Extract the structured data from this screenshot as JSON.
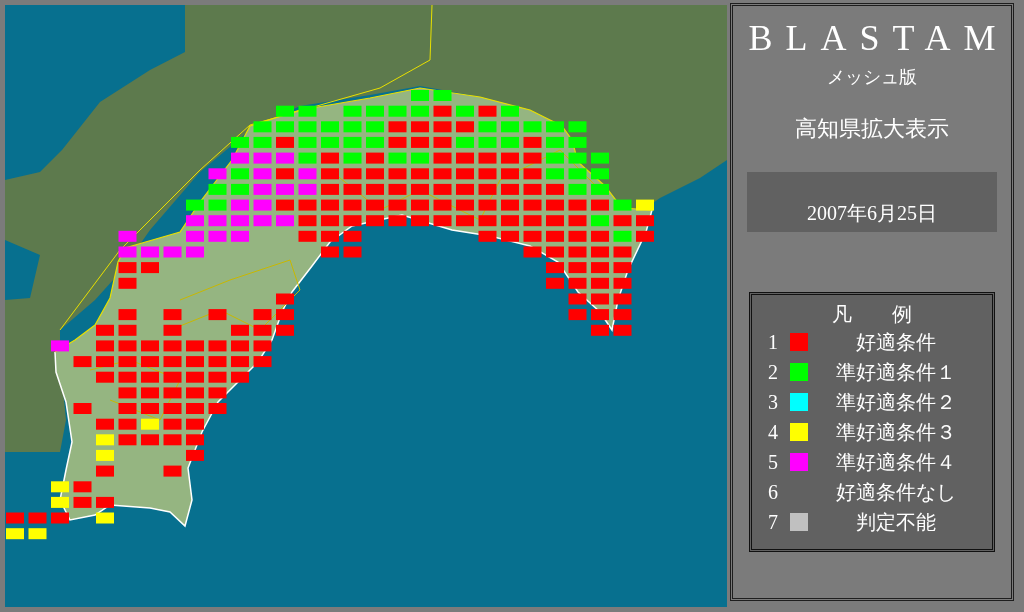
{
  "app_title": "BLASTAM",
  "subtitle": "メッシュ版",
  "view_label": "高知県拡大表示",
  "date": "2007年6月25日",
  "legend": {
    "title": "凡　　例",
    "items": [
      {
        "number": "1",
        "label": "好適条件",
        "kind": "r",
        "color": "#ff0000"
      },
      {
        "number": "2",
        "label": "準好適条件１",
        "kind": "g",
        "color": "#00ff00"
      },
      {
        "number": "3",
        "label": "準好適条件２",
        "kind": "c",
        "color": "#00ffff"
      },
      {
        "number": "4",
        "label": "準好適条件３",
        "kind": "y",
        "color": "#ffff00"
      },
      {
        "number": "5",
        "label": "準好適条件４",
        "kind": "m",
        "color": "#ff00ff"
      },
      {
        "number": "6",
        "label": "好適条件なし",
        "kind": "n"
      },
      {
        "number": "7",
        "label": "判定不能",
        "kind": "s",
        "color": "#c0c0c0"
      }
    ]
  },
  "mesh": [
    {
      "cells": [
        {
          "kind": "o"
        },
        {
          "kind": "o"
        },
        {
          "kind": "o"
        },
        {
          "kind": "o"
        },
        {
          "kind": "o"
        },
        {
          "kind": "o"
        },
        {
          "kind": "o"
        },
        {
          "kind": "o"
        },
        {
          "kind": "o"
        },
        {
          "kind": "o"
        },
        {
          "kind": "o"
        },
        {
          "kind": "o"
        },
        {
          "kind": "o"
        },
        {
          "kind": "o"
        },
        {
          "kind": "o"
        },
        {
          "kind": "o"
        },
        {
          "kind": "o"
        },
        {
          "kind": "o"
        },
        {
          "kind": "g"
        },
        {
          "kind": "g"
        }
      ]
    },
    {
      "cells": [
        {
          "kind": "o"
        },
        {
          "kind": "o"
        },
        {
          "kind": "o"
        },
        {
          "kind": "o"
        },
        {
          "kind": "o"
        },
        {
          "kind": "o"
        },
        {
          "kind": "o"
        },
        {
          "kind": "o"
        },
        {
          "kind": "o"
        },
        {
          "kind": "o"
        },
        {
          "kind": "o"
        },
        {
          "kind": "o"
        },
        {
          "kind": "g"
        },
        {
          "kind": "g"
        },
        {
          "kind": "o"
        },
        {
          "kind": "g"
        },
        {
          "kind": "g"
        },
        {
          "kind": "g"
        },
        {
          "kind": "g"
        },
        {
          "kind": "r"
        },
        {
          "kind": "g"
        },
        {
          "kind": "r"
        },
        {
          "kind": "g"
        }
      ]
    },
    {
      "cells": [
        {
          "kind": "o"
        },
        {
          "kind": "o"
        },
        {
          "kind": "o"
        },
        {
          "kind": "o"
        },
        {
          "kind": "o"
        },
        {
          "kind": "o"
        },
        {
          "kind": "o"
        },
        {
          "kind": "o"
        },
        {
          "kind": "o"
        },
        {
          "kind": "o"
        },
        {
          "kind": "o"
        },
        {
          "kind": "g"
        },
        {
          "kind": "g"
        },
        {
          "kind": "g"
        },
        {
          "kind": "g"
        },
        {
          "kind": "g"
        },
        {
          "kind": "g"
        },
        {
          "kind": "r"
        },
        {
          "kind": "r"
        },
        {
          "kind": "r"
        },
        {
          "kind": "r"
        },
        {
          "kind": "g"
        },
        {
          "kind": "g"
        },
        {
          "kind": "g"
        },
        {
          "kind": "g"
        },
        {
          "kind": "g"
        }
      ]
    },
    {
      "cells": [
        {
          "kind": "o"
        },
        {
          "kind": "o"
        },
        {
          "kind": "o"
        },
        {
          "kind": "o"
        },
        {
          "kind": "o"
        },
        {
          "kind": "o"
        },
        {
          "kind": "o"
        },
        {
          "kind": "o"
        },
        {
          "kind": "o"
        },
        {
          "kind": "o"
        },
        {
          "kind": "g"
        },
        {
          "kind": "g"
        },
        {
          "kind": "r"
        },
        {
          "kind": "g"
        },
        {
          "kind": "g"
        },
        {
          "kind": "g"
        },
        {
          "kind": "g"
        },
        {
          "kind": "r"
        },
        {
          "kind": "r"
        },
        {
          "kind": "r"
        },
        {
          "kind": "g"
        },
        {
          "kind": "g"
        },
        {
          "kind": "g"
        },
        {
          "kind": "r"
        },
        {
          "kind": "g"
        },
        {
          "kind": "g"
        }
      ]
    },
    {
      "cells": [
        {
          "kind": "o"
        },
        {
          "kind": "o"
        },
        {
          "kind": "o"
        },
        {
          "kind": "o"
        },
        {
          "kind": "o"
        },
        {
          "kind": "o"
        },
        {
          "kind": "o"
        },
        {
          "kind": "o"
        },
        {
          "kind": "o"
        },
        {
          "kind": "o"
        },
        {
          "kind": "m"
        },
        {
          "kind": "m"
        },
        {
          "kind": "m"
        },
        {
          "kind": "g"
        },
        {
          "kind": "r"
        },
        {
          "kind": "g"
        },
        {
          "kind": "r"
        },
        {
          "kind": "g"
        },
        {
          "kind": "g"
        },
        {
          "kind": "r"
        },
        {
          "kind": "r"
        },
        {
          "kind": "r"
        },
        {
          "kind": "r"
        },
        {
          "kind": "r"
        },
        {
          "kind": "g"
        },
        {
          "kind": "g"
        },
        {
          "kind": "g"
        }
      ]
    },
    {
      "cells": [
        {
          "kind": "o"
        },
        {
          "kind": "o"
        },
        {
          "kind": "o"
        },
        {
          "kind": "o"
        },
        {
          "kind": "o"
        },
        {
          "kind": "o"
        },
        {
          "kind": "o"
        },
        {
          "kind": "o"
        },
        {
          "kind": "o"
        },
        {
          "kind": "m"
        },
        {
          "kind": "g"
        },
        {
          "kind": "m"
        },
        {
          "kind": "r"
        },
        {
          "kind": "m"
        },
        {
          "kind": "r"
        },
        {
          "kind": "r"
        },
        {
          "kind": "r"
        },
        {
          "kind": "r"
        },
        {
          "kind": "r"
        },
        {
          "kind": "r"
        },
        {
          "kind": "r"
        },
        {
          "kind": "r"
        },
        {
          "kind": "r"
        },
        {
          "kind": "r"
        },
        {
          "kind": "g"
        },
        {
          "kind": "g"
        },
        {
          "kind": "g"
        }
      ]
    },
    {
      "cells": [
        {
          "kind": "o"
        },
        {
          "kind": "o"
        },
        {
          "kind": "o"
        },
        {
          "kind": "o"
        },
        {
          "kind": "o"
        },
        {
          "kind": "o"
        },
        {
          "kind": "o"
        },
        {
          "kind": "o"
        },
        {
          "kind": "o"
        },
        {
          "kind": "g"
        },
        {
          "kind": "g"
        },
        {
          "kind": "m"
        },
        {
          "kind": "m"
        },
        {
          "kind": "m"
        },
        {
          "kind": "r"
        },
        {
          "kind": "r"
        },
        {
          "kind": "r"
        },
        {
          "kind": "r"
        },
        {
          "kind": "r"
        },
        {
          "kind": "r"
        },
        {
          "kind": "r"
        },
        {
          "kind": "r"
        },
        {
          "kind": "r"
        },
        {
          "kind": "r"
        },
        {
          "kind": "r"
        },
        {
          "kind": "g"
        },
        {
          "kind": "g"
        }
      ]
    },
    {
      "cells": [
        {
          "kind": "o"
        },
        {
          "kind": "o"
        },
        {
          "kind": "o"
        },
        {
          "kind": "o"
        },
        {
          "kind": "o"
        },
        {
          "kind": "o"
        },
        {
          "kind": "o"
        },
        {
          "kind": "o"
        },
        {
          "kind": "g"
        },
        {
          "kind": "g"
        },
        {
          "kind": "m"
        },
        {
          "kind": "m"
        },
        {
          "kind": "r"
        },
        {
          "kind": "r"
        },
        {
          "kind": "r"
        },
        {
          "kind": "r"
        },
        {
          "kind": "r"
        },
        {
          "kind": "r"
        },
        {
          "kind": "r"
        },
        {
          "kind": "r"
        },
        {
          "kind": "r"
        },
        {
          "kind": "r"
        },
        {
          "kind": "r"
        },
        {
          "kind": "r"
        },
        {
          "kind": "r"
        },
        {
          "kind": "r"
        },
        {
          "kind": "r"
        },
        {
          "kind": "g"
        },
        {
          "kind": "y"
        }
      ]
    },
    {
      "cells": [
        {
          "kind": "o"
        },
        {
          "kind": "o"
        },
        {
          "kind": "o"
        },
        {
          "kind": "o"
        },
        {
          "kind": "o"
        },
        {
          "kind": "o"
        },
        {
          "kind": "o"
        },
        {
          "kind": "o"
        },
        {
          "kind": "m"
        },
        {
          "kind": "m"
        },
        {
          "kind": "m"
        },
        {
          "kind": "m"
        },
        {
          "kind": "m"
        },
        {
          "kind": "r"
        },
        {
          "kind": "r"
        },
        {
          "kind": "r"
        },
        {
          "kind": "r"
        },
        {
          "kind": "r"
        },
        {
          "kind": "r"
        },
        {
          "kind": "r"
        },
        {
          "kind": "r"
        },
        {
          "kind": "r"
        },
        {
          "kind": "r"
        },
        {
          "kind": "r"
        },
        {
          "kind": "r"
        },
        {
          "kind": "r"
        },
        {
          "kind": "g"
        },
        {
          "kind": "r"
        },
        {
          "kind": "r"
        }
      ]
    },
    {
      "cells": [
        {
          "kind": "o"
        },
        {
          "kind": "o"
        },
        {
          "kind": "o"
        },
        {
          "kind": "o"
        },
        {
          "kind": "o"
        },
        {
          "kind": "m"
        },
        {
          "kind": "o"
        },
        {
          "kind": "o"
        },
        {
          "kind": "m"
        },
        {
          "kind": "m"
        },
        {
          "kind": "m"
        },
        {
          "kind": "o"
        },
        {
          "kind": "o"
        },
        {
          "kind": "r"
        },
        {
          "kind": "r"
        },
        {
          "kind": "r"
        },
        {
          "kind": "o"
        },
        {
          "kind": "o"
        },
        {
          "kind": "o"
        },
        {
          "kind": "o"
        },
        {
          "kind": "o"
        },
        {
          "kind": "r"
        },
        {
          "kind": "r"
        },
        {
          "kind": "r"
        },
        {
          "kind": "r"
        },
        {
          "kind": "r"
        },
        {
          "kind": "r"
        },
        {
          "kind": "g"
        },
        {
          "kind": "r"
        }
      ]
    },
    {
      "cells": [
        {
          "kind": "o"
        },
        {
          "kind": "o"
        },
        {
          "kind": "o"
        },
        {
          "kind": "o"
        },
        {
          "kind": "o"
        },
        {
          "kind": "m"
        },
        {
          "kind": "m"
        },
        {
          "kind": "m"
        },
        {
          "kind": "m"
        },
        {
          "kind": "o"
        },
        {
          "kind": "o"
        },
        {
          "kind": "o"
        },
        {
          "kind": "o"
        },
        {
          "kind": "o"
        },
        {
          "kind": "r"
        },
        {
          "kind": "r"
        },
        {
          "kind": "o"
        },
        {
          "kind": "o"
        },
        {
          "kind": "o"
        },
        {
          "kind": "o"
        },
        {
          "kind": "o"
        },
        {
          "kind": "o"
        },
        {
          "kind": "o"
        },
        {
          "kind": "r"
        },
        {
          "kind": "r"
        },
        {
          "kind": "r"
        },
        {
          "kind": "r"
        },
        {
          "kind": "r"
        }
      ]
    },
    {
      "cells": [
        {
          "kind": "o"
        },
        {
          "kind": "o"
        },
        {
          "kind": "o"
        },
        {
          "kind": "o"
        },
        {
          "kind": "o"
        },
        {
          "kind": "r"
        },
        {
          "kind": "r"
        },
        {
          "kind": "o"
        },
        {
          "kind": "o"
        },
        {
          "kind": "o"
        },
        {
          "kind": "o"
        },
        {
          "kind": "o"
        },
        {
          "kind": "o"
        },
        {
          "kind": "o"
        },
        {
          "kind": "o"
        },
        {
          "kind": "o"
        },
        {
          "kind": "o"
        },
        {
          "kind": "o"
        },
        {
          "kind": "o"
        },
        {
          "kind": "o"
        },
        {
          "kind": "o"
        },
        {
          "kind": "o"
        },
        {
          "kind": "o"
        },
        {
          "kind": "o"
        },
        {
          "kind": "r"
        },
        {
          "kind": "r"
        },
        {
          "kind": "r"
        },
        {
          "kind": "r"
        }
      ]
    },
    {
      "cells": [
        {
          "kind": "o"
        },
        {
          "kind": "o"
        },
        {
          "kind": "o"
        },
        {
          "kind": "o"
        },
        {
          "kind": "o"
        },
        {
          "kind": "r"
        },
        {
          "kind": "o"
        },
        {
          "kind": "o"
        },
        {
          "kind": "o"
        },
        {
          "kind": "o"
        },
        {
          "kind": "o"
        },
        {
          "kind": "o"
        },
        {
          "kind": "o"
        },
        {
          "kind": "o"
        },
        {
          "kind": "o"
        },
        {
          "kind": "o"
        },
        {
          "kind": "o"
        },
        {
          "kind": "o"
        },
        {
          "kind": "o"
        },
        {
          "kind": "o"
        },
        {
          "kind": "o"
        },
        {
          "kind": "o"
        },
        {
          "kind": "o"
        },
        {
          "kind": "o"
        },
        {
          "kind": "r"
        },
        {
          "kind": "r"
        },
        {
          "kind": "r"
        },
        {
          "kind": "r"
        }
      ]
    },
    {
      "cells": [
        {
          "kind": "o"
        },
        {
          "kind": "o"
        },
        {
          "kind": "o"
        },
        {
          "kind": "o"
        },
        {
          "kind": "o"
        },
        {
          "kind": "o"
        },
        {
          "kind": "o"
        },
        {
          "kind": "o"
        },
        {
          "kind": "o"
        },
        {
          "kind": "o"
        },
        {
          "kind": "o"
        },
        {
          "kind": "o"
        },
        {
          "kind": "r"
        },
        {
          "kind": "o"
        },
        {
          "kind": "o"
        },
        {
          "kind": "o"
        },
        {
          "kind": "o"
        },
        {
          "kind": "o"
        },
        {
          "kind": "o"
        },
        {
          "kind": "o"
        },
        {
          "kind": "o"
        },
        {
          "kind": "o"
        },
        {
          "kind": "o"
        },
        {
          "kind": "o"
        },
        {
          "kind": "o"
        },
        {
          "kind": "r"
        },
        {
          "kind": "r"
        },
        {
          "kind": "r"
        }
      ]
    },
    {
      "cells": [
        {
          "kind": "o"
        },
        {
          "kind": "o"
        },
        {
          "kind": "o"
        },
        {
          "kind": "o"
        },
        {
          "kind": "o"
        },
        {
          "kind": "r"
        },
        {
          "kind": "o"
        },
        {
          "kind": "r"
        },
        {
          "kind": "o"
        },
        {
          "kind": "r"
        },
        {
          "kind": "o"
        },
        {
          "kind": "r"
        },
        {
          "kind": "r"
        },
        {
          "kind": "o"
        },
        {
          "kind": "o"
        },
        {
          "kind": "o"
        },
        {
          "kind": "o"
        },
        {
          "kind": "o"
        },
        {
          "kind": "o"
        },
        {
          "kind": "o"
        },
        {
          "kind": "o"
        },
        {
          "kind": "o"
        },
        {
          "kind": "o"
        },
        {
          "kind": "o"
        },
        {
          "kind": "o"
        },
        {
          "kind": "r"
        },
        {
          "kind": "r"
        },
        {
          "kind": "r"
        }
      ]
    },
    {
      "cells": [
        {
          "kind": "o"
        },
        {
          "kind": "o"
        },
        {
          "kind": "o"
        },
        {
          "kind": "o"
        },
        {
          "kind": "r"
        },
        {
          "kind": "r"
        },
        {
          "kind": "o"
        },
        {
          "kind": "r"
        },
        {
          "kind": "o"
        },
        {
          "kind": "o"
        },
        {
          "kind": "r"
        },
        {
          "kind": "r"
        },
        {
          "kind": "r"
        },
        {
          "kind": "o"
        },
        {
          "kind": "o"
        },
        {
          "kind": "o"
        },
        {
          "kind": "o"
        },
        {
          "kind": "o"
        },
        {
          "kind": "o"
        },
        {
          "kind": "o"
        },
        {
          "kind": "o"
        },
        {
          "kind": "o"
        },
        {
          "kind": "o"
        },
        {
          "kind": "o"
        },
        {
          "kind": "o"
        },
        {
          "kind": "o"
        },
        {
          "kind": "r"
        },
        {
          "kind": "r"
        }
      ]
    },
    {
      "cells": [
        {
          "kind": "o"
        },
        {
          "kind": "o"
        },
        {
          "kind": "m"
        },
        {
          "kind": "o"
        },
        {
          "kind": "r"
        },
        {
          "kind": "r"
        },
        {
          "kind": "r"
        },
        {
          "kind": "r"
        },
        {
          "kind": "r"
        },
        {
          "kind": "r"
        },
        {
          "kind": "r"
        },
        {
          "kind": "r"
        }
      ]
    },
    {
      "cells": [
        {
          "kind": "o"
        },
        {
          "kind": "o"
        },
        {
          "kind": "o"
        },
        {
          "kind": "r"
        },
        {
          "kind": "r"
        },
        {
          "kind": "r"
        },
        {
          "kind": "r"
        },
        {
          "kind": "r"
        },
        {
          "kind": "r"
        },
        {
          "kind": "r"
        },
        {
          "kind": "r"
        },
        {
          "kind": "r"
        }
      ]
    },
    {
      "cells": [
        {
          "kind": "o"
        },
        {
          "kind": "o"
        },
        {
          "kind": "o"
        },
        {
          "kind": "o"
        },
        {
          "kind": "r"
        },
        {
          "kind": "r"
        },
        {
          "kind": "r"
        },
        {
          "kind": "r"
        },
        {
          "kind": "r"
        },
        {
          "kind": "r"
        },
        {
          "kind": "r"
        }
      ]
    },
    {
      "cells": [
        {
          "kind": "o"
        },
        {
          "kind": "o"
        },
        {
          "kind": "o"
        },
        {
          "kind": "o"
        },
        {
          "kind": "o"
        },
        {
          "kind": "r"
        },
        {
          "kind": "r"
        },
        {
          "kind": "r"
        },
        {
          "kind": "r"
        },
        {
          "kind": "r"
        }
      ]
    },
    {
      "cells": [
        {
          "kind": "o"
        },
        {
          "kind": "o"
        },
        {
          "kind": "o"
        },
        {
          "kind": "r"
        },
        {
          "kind": "o"
        },
        {
          "kind": "r"
        },
        {
          "kind": "r"
        },
        {
          "kind": "r"
        },
        {
          "kind": "r"
        },
        {
          "kind": "r"
        }
      ]
    },
    {
      "cells": [
        {
          "kind": "o"
        },
        {
          "kind": "o"
        },
        {
          "kind": "o"
        },
        {
          "kind": "o"
        },
        {
          "kind": "r"
        },
        {
          "kind": "r"
        },
        {
          "kind": "y"
        },
        {
          "kind": "r"
        },
        {
          "kind": "r"
        }
      ]
    },
    {
      "cells": [
        {
          "kind": "o"
        },
        {
          "kind": "o"
        },
        {
          "kind": "o"
        },
        {
          "kind": "o"
        },
        {
          "kind": "y"
        },
        {
          "kind": "r"
        },
        {
          "kind": "r"
        },
        {
          "kind": "r"
        },
        {
          "kind": "r"
        }
      ]
    },
    {
      "cells": [
        {
          "kind": "o"
        },
        {
          "kind": "o"
        },
        {
          "kind": "o"
        },
        {
          "kind": "o"
        },
        {
          "kind": "y"
        },
        {
          "kind": "o"
        },
        {
          "kind": "o"
        },
        {
          "kind": "o"
        },
        {
          "kind": "r"
        }
      ]
    },
    {
      "cells": [
        {
          "kind": "o"
        },
        {
          "kind": "o"
        },
        {
          "kind": "o"
        },
        {
          "kind": "o"
        },
        {
          "kind": "r"
        },
        {
          "kind": "o"
        },
        {
          "kind": "o"
        },
        {
          "kind": "r"
        }
      ]
    },
    {
      "cells": [
        {
          "kind": "o"
        },
        {
          "kind": "o"
        },
        {
          "kind": "y"
        },
        {
          "kind": "r"
        }
      ]
    },
    {
      "cells": [
        {
          "kind": "o"
        },
        {
          "kind": "o"
        },
        {
          "kind": "y"
        },
        {
          "kind": "r"
        },
        {
          "kind": "r"
        }
      ]
    },
    {
      "cells": [
        {
          "kind": "r"
        },
        {
          "kind": "r"
        },
        {
          "kind": "r"
        },
        {
          "kind": "o"
        },
        {
          "kind": "y"
        }
      ]
    },
    {
      "cells": [
        {
          "kind": "y"
        },
        {
          "kind": "y"
        }
      ]
    }
  ]
}
